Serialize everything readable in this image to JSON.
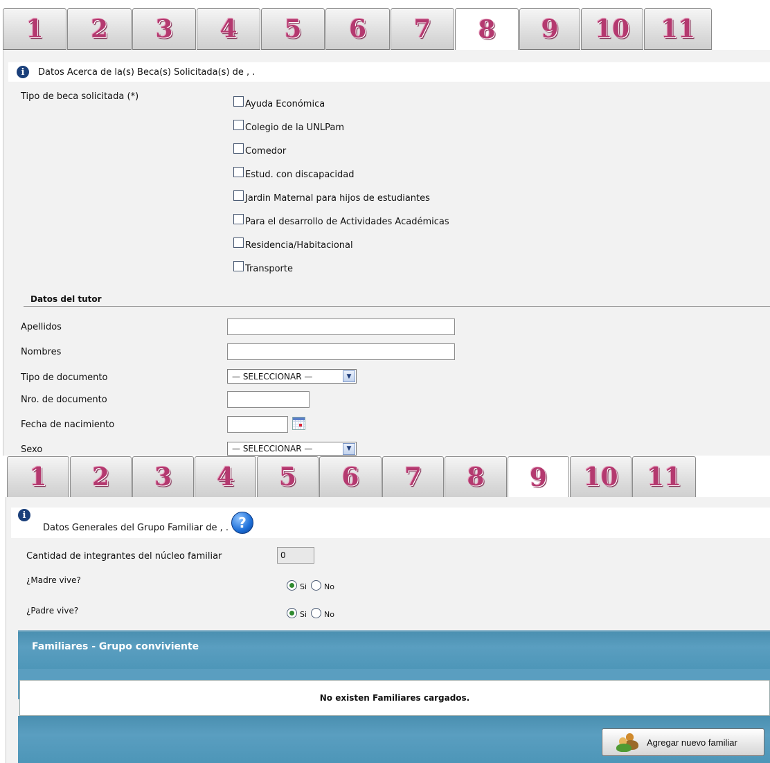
{
  "tabs_top": {
    "labels": [
      "1",
      "2",
      "3",
      "4",
      "5",
      "6",
      "7",
      "8",
      "9",
      "10",
      "11"
    ],
    "active": "8"
  },
  "tabs_bottom": {
    "labels": [
      "1",
      "2",
      "3",
      "4",
      "5",
      "6",
      "7",
      "8",
      "9",
      "10",
      "11"
    ],
    "active": "9"
  },
  "beca_section": {
    "info_text": "Datos Acerca de la(s) Beca(s) Solicitada(s) de , .",
    "tipo_label": "Tipo de beca solicitada (*)",
    "options": [
      "Ayuda Económica",
      "Colegio de la UNLPam",
      "Comedor",
      "Estud. con discapacidad",
      "Jardin Maternal para hijos de estudiantes",
      "Para el desarrollo de Actividades Académicas",
      "Residencia/Habitacional",
      "Transporte"
    ]
  },
  "tutor_section": {
    "heading": "Datos del tutor",
    "apellidos_label": "Apellidos",
    "apellidos_value": "",
    "nombres_label": "Nombres",
    "nombres_value": "",
    "tipo_doc_label": "Tipo de documento",
    "tipo_doc_selected": "— SELECCIONAR —",
    "nro_doc_label": "Nro. de documento",
    "nro_doc_value": "",
    "fecha_label": "Fecha de nacimiento",
    "fecha_value": "",
    "sexo_label": "Sexo",
    "sexo_selected": "— SELECCIONAR —"
  },
  "familia_section": {
    "info_text": "Datos Generales del Grupo Familiar de , .",
    "help_symbol": "?",
    "cantidad_label": "Cantidad de integrantes del núcleo familiar",
    "cantidad_value": "0",
    "madre_label": "¿Madre vive?",
    "madre_value": "Si",
    "padre_label": "¿Padre vive?",
    "padre_value": "Si",
    "radio_si": "Si",
    "radio_no": "No"
  },
  "familiares_grid": {
    "title": "Familiares - Grupo conviviente",
    "empty_message": "No existen Familiares cargados.",
    "add_button": "Agregar nuevo familiar"
  },
  "icons": {
    "info": "info-icon",
    "help": "help-icon",
    "calendar": "calendar-icon",
    "add_people": "people-icon"
  },
  "colors": {
    "tab_digit": "#b4396f",
    "grid_header": "#4d96b8",
    "panel_bg": "#f2f2f2"
  }
}
